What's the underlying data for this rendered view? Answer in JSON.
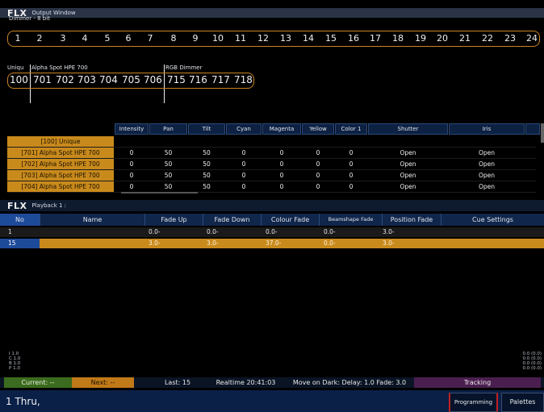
{
  "output": {
    "logo": "FLX",
    "title": "Output Window",
    "dimmer_label": "Dimmer - 8 bit",
    "channels": [
      "1",
      "2",
      "3",
      "4",
      "5",
      "6",
      "7",
      "8",
      "9",
      "10",
      "11",
      "12",
      "13",
      "14",
      "15",
      "16",
      "17",
      "18",
      "19",
      "20",
      "21",
      "22",
      "23",
      "24"
    ],
    "groups": [
      {
        "label": "Uniqu"
      },
      {
        "label": "Alpha Spot HPE 700"
      },
      {
        "label": "RGB Dimmer"
      }
    ],
    "group_numbers": [
      "100",
      "701",
      "702",
      "703",
      "704",
      "705",
      "706",
      "715",
      "716",
      "717",
      "718"
    ],
    "fixture_columns": [
      "Intensity",
      "Pan",
      "Tilt",
      "Cyan",
      "Magenta",
      "Yellow",
      "Color 1",
      "Shutter",
      "Iris"
    ],
    "fixtures": [
      {
        "label": "[100] Unique",
        "values": [
          "",
          "",
          "",
          "",
          "",
          "",
          "",
          "",
          ""
        ]
      },
      {
        "label": "[701] Alpha Spot HPE 700",
        "values": [
          "0",
          "50",
          "50",
          "0",
          "0",
          "0",
          "0",
          "Open",
          "Open"
        ]
      },
      {
        "label": "[702] Alpha Spot HPE 700",
        "values": [
          "0",
          "50",
          "50",
          "0",
          "0",
          "0",
          "0",
          "Open",
          "Open"
        ]
      },
      {
        "label": "[703] Alpha Spot HPE 700",
        "values": [
          "0",
          "50",
          "50",
          "0",
          "0",
          "0",
          "0",
          "Open",
          "Open"
        ]
      },
      {
        "label": "[704] Alpha Spot HPE 700",
        "values": [
          "0",
          "50",
          "50",
          "0",
          "0",
          "0",
          "0",
          "Open",
          "Open"
        ]
      }
    ]
  },
  "playback": {
    "logo": "FLX",
    "title": "Playback 1 :",
    "columns": [
      "No",
      "Name",
      "Fade Up",
      "Fade Down",
      "Colour Fade",
      "Beamshape Fade",
      "Position Fade",
      "Cue Settings"
    ],
    "rows": [
      {
        "no": "1",
        "name": "",
        "fade_up": "0.0-",
        "fade_down": "0.0-",
        "colour": "0.0-",
        "beam": "0.0-",
        "position": "3.0-"
      },
      {
        "no": "15",
        "name": "",
        "fade_up": "3.0-",
        "fade_down": "3.0-",
        "colour": "37.0-",
        "beam": "0.0-",
        "position": "3.0-"
      }
    ],
    "meters_left": [
      "I 1.0",
      "C 1.0",
      "B 1.0",
      "P 1.0"
    ],
    "meters_right": [
      "0.0 (0.0)",
      "0.0 (0.0)",
      "0.0 (0.0)",
      "0.0 (0.0)"
    ]
  },
  "status": {
    "current": "Current: --",
    "next": "Next: --",
    "last": "Last: 15",
    "realtime": "Realtime 20:41:03",
    "move_on_dark": "Move on Dark: Delay: 1.0  Fade: 3.0",
    "mode": "Tracking"
  },
  "command": {
    "text": "1 Thru,",
    "programming": "Programming",
    "palettes": "Palettes"
  },
  "colors": {
    "accent_orange": "#c98a1c",
    "header_blue": "#10264b",
    "selected_blue": "#1e4a9a",
    "current_green": "#3b6b1e",
    "next_orange": "#c07a18",
    "tracking_purple": "#4a1f4f",
    "programming_red": "#c02020"
  }
}
